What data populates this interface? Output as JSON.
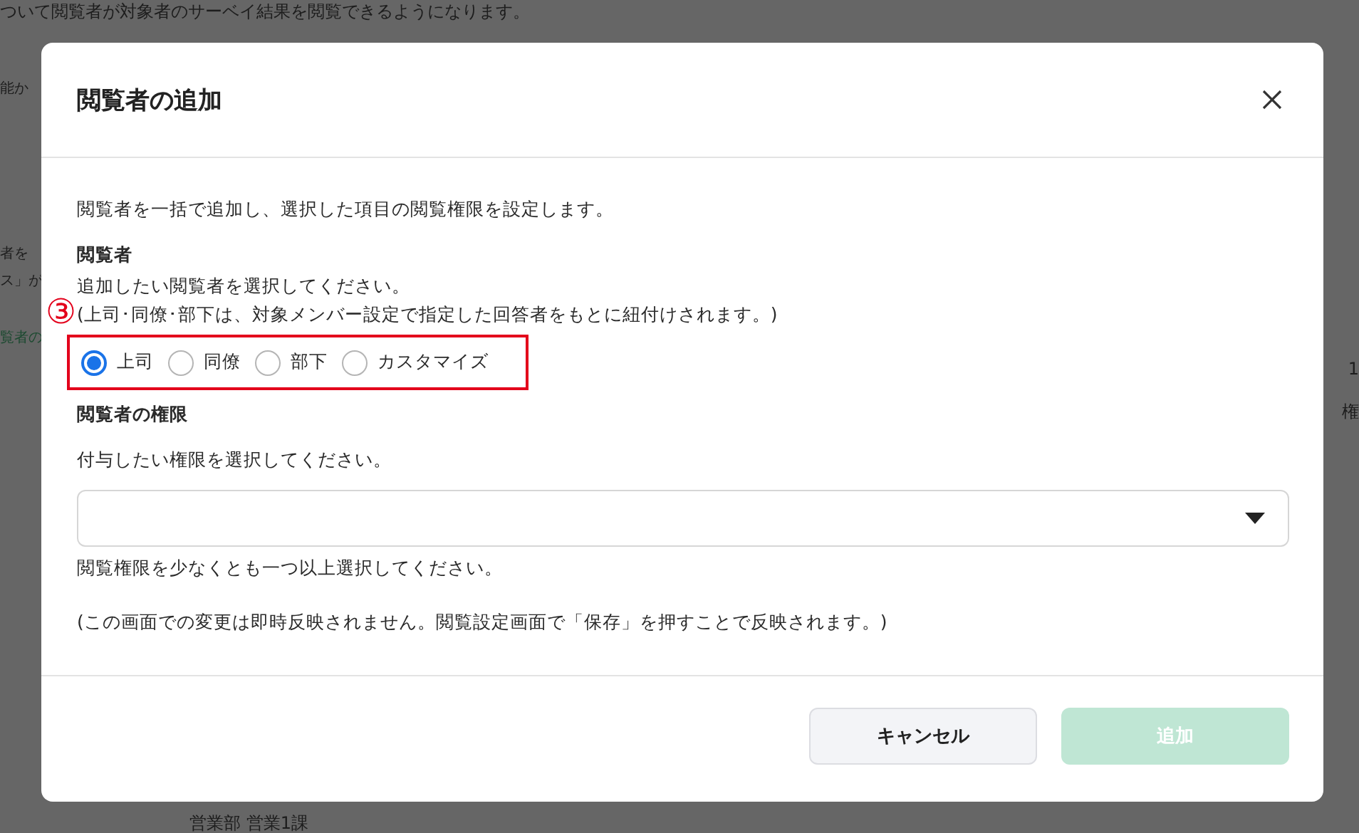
{
  "background": {
    "top_text": "ついて閲覧者が対象者のサーベイ結果を閲覧できるようになります。",
    "left_fragments": [
      {
        "text": "能か",
        "kind": "plain"
      },
      {
        "text": "者を",
        "kind": "plain"
      },
      {
        "text": "ス」が",
        "kind": "plain"
      },
      {
        "text": "覧者の",
        "kind": "link"
      }
    ],
    "right_fragments": [
      "1",
      "権"
    ],
    "bottom_text": "営業部  営業1課"
  },
  "dialog": {
    "title": "閲覧者の追加",
    "intro": "閲覧者を一括で追加し、選択した項目の閲覧権限を設定します。",
    "viewers": {
      "heading": "閲覧者",
      "hint": "追加したい閲覧者を選択してください。",
      "note": "(上司･同僚･部下は、対象メンバー設定で指定した回答者をもとに紐付けされます。)",
      "annotation_number": "③",
      "options": [
        {
          "label": "上司",
          "selected": true
        },
        {
          "label": "同僚",
          "selected": false
        },
        {
          "label": "部下",
          "selected": false
        },
        {
          "label": "カスタマイズ",
          "selected": false
        }
      ]
    },
    "permissions": {
      "heading": "閲覧者の権限",
      "hint": "付与したい権限を選択してください。",
      "error": "閲覧権限を少なくとも一つ以上選択してください。"
    },
    "footnote": "(この画面での変更は即時反映されません。閲覧設定画面で「保存」を押すことで反映されます。)",
    "buttons": [
      {
        "label": "キャンセル",
        "kind": "secondary",
        "disabled": false
      },
      {
        "label": "追加",
        "kind": "primary",
        "disabled": true
      }
    ]
  }
}
